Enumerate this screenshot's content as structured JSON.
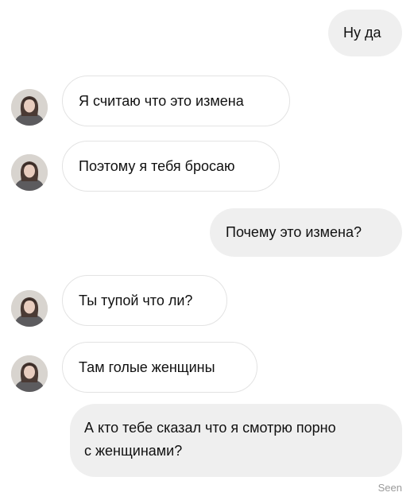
{
  "conversation": {
    "messages": [
      {
        "sender": "me",
        "text": "Ну да"
      },
      {
        "sender": "other",
        "text": "Я считаю что это измена"
      },
      {
        "sender": "other",
        "text": "Поэтому я тебя бросаю"
      },
      {
        "sender": "me",
        "text": "Почему это измена?"
      },
      {
        "sender": "other",
        "text": "Ты тупой что ли?"
      },
      {
        "sender": "other",
        "text": "Там голые женщины"
      },
      {
        "sender": "me",
        "lines": [
          "А кто тебе сказал что я смотрю порно",
          "с женщинами?"
        ]
      }
    ],
    "status": "Seen"
  },
  "colors": {
    "outgoing_bubble": "#efefef",
    "incoming_bubble": "#ffffff",
    "incoming_border": "#e3e3e3",
    "status_text": "#9a9a9a"
  },
  "icons": {
    "contact_avatar": "avatar-photo-icon"
  }
}
